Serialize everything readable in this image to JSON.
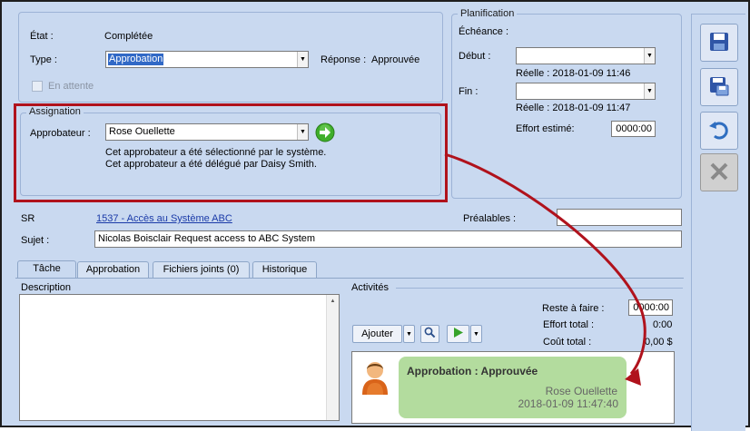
{
  "status": {
    "etat_label": "État :",
    "etat_value": "Complétée",
    "type_label": "Type :",
    "type_value": "Approbation",
    "reponse_label": "Réponse :",
    "reponse_value": "Approuvée",
    "en_attente_label": "En attente"
  },
  "planification": {
    "title": "Planification",
    "echeance_label": "Échéance :",
    "debut_label": "Début :",
    "debut_value": "",
    "debut_reelle": "Réelle : 2018-01-09 11:46",
    "fin_label": "Fin :",
    "fin_value": "",
    "fin_reelle": "Réelle : 2018-01-09 11:47",
    "effort_label": "Effort estimé:",
    "effort_value": "0000:00"
  },
  "assignation": {
    "title": "Assignation",
    "approbateur_label": "Approbateur :",
    "approbateur_value": "Rose Ouellette",
    "note1": "Cet approbateur a été sélectionné par le système.",
    "note2": "Cet approbateur a été délégué par Daisy Smith."
  },
  "sr": {
    "label": "SR",
    "link": "1537 - Accès au Système ABC",
    "prealables_label": "Préalables :",
    "prealables_value": ""
  },
  "sujet": {
    "label": "Sujet :",
    "value": "Nicolas Boisclair Request access to ABC System"
  },
  "tabs": [
    {
      "label": "Tâche"
    },
    {
      "label": "Approbation"
    },
    {
      "label": "Fichiers joints (0)"
    },
    {
      "label": "Historique"
    }
  ],
  "description": {
    "label": "Description"
  },
  "activites": {
    "label": "Activités",
    "reste_label": "Reste à faire :",
    "reste_value": "0000:00",
    "effort_total_label": "Effort total :",
    "effort_total_value": "0:00",
    "cout_label": "Coût total :",
    "cout_value": "0,00 $",
    "ajouter_label": "Ajouter"
  },
  "activity": {
    "title": "Approbation : Approuvée",
    "person": "Rose Ouellette",
    "datetime": "2018-01-09 11:47:40"
  },
  "colors": {
    "highlight": "#b0121c",
    "bubble": "#b3dc9e",
    "panel": "#c9d9f0"
  }
}
